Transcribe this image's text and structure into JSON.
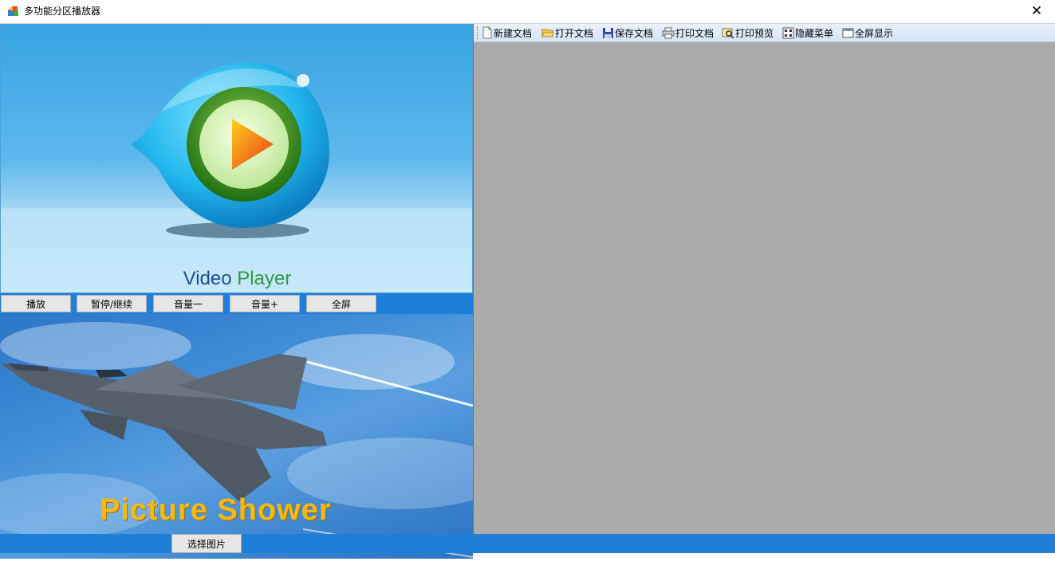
{
  "window": {
    "title": "多功能分区播放器",
    "close_glyph": "✕"
  },
  "video": {
    "label_word1": "Video",
    "label_word2": "Player",
    "controls": [
      "播放",
      "暂停/继续",
      "音量一",
      "音量+",
      "全屏"
    ]
  },
  "picture": {
    "label": "Picture Shower",
    "select_button": "选择图片"
  },
  "toolbar": {
    "items": [
      {
        "label": "新建文档",
        "icon": "new-document-icon"
      },
      {
        "label": "打开文档",
        "icon": "open-folder-icon"
      },
      {
        "label": "保存文档",
        "icon": "save-disk-icon"
      },
      {
        "label": "打印文档",
        "icon": "printer-icon"
      },
      {
        "label": "打印预览",
        "icon": "print-preview-icon"
      },
      {
        "label": "隐藏菜单",
        "icon": "hide-menu-icon"
      },
      {
        "label": "全屏显示",
        "icon": "fullscreen-icon"
      }
    ]
  },
  "colors": {
    "accent_blue": "#1e7fd9",
    "document_area": "#aaaaaa",
    "picture_label": "#f5b915"
  }
}
